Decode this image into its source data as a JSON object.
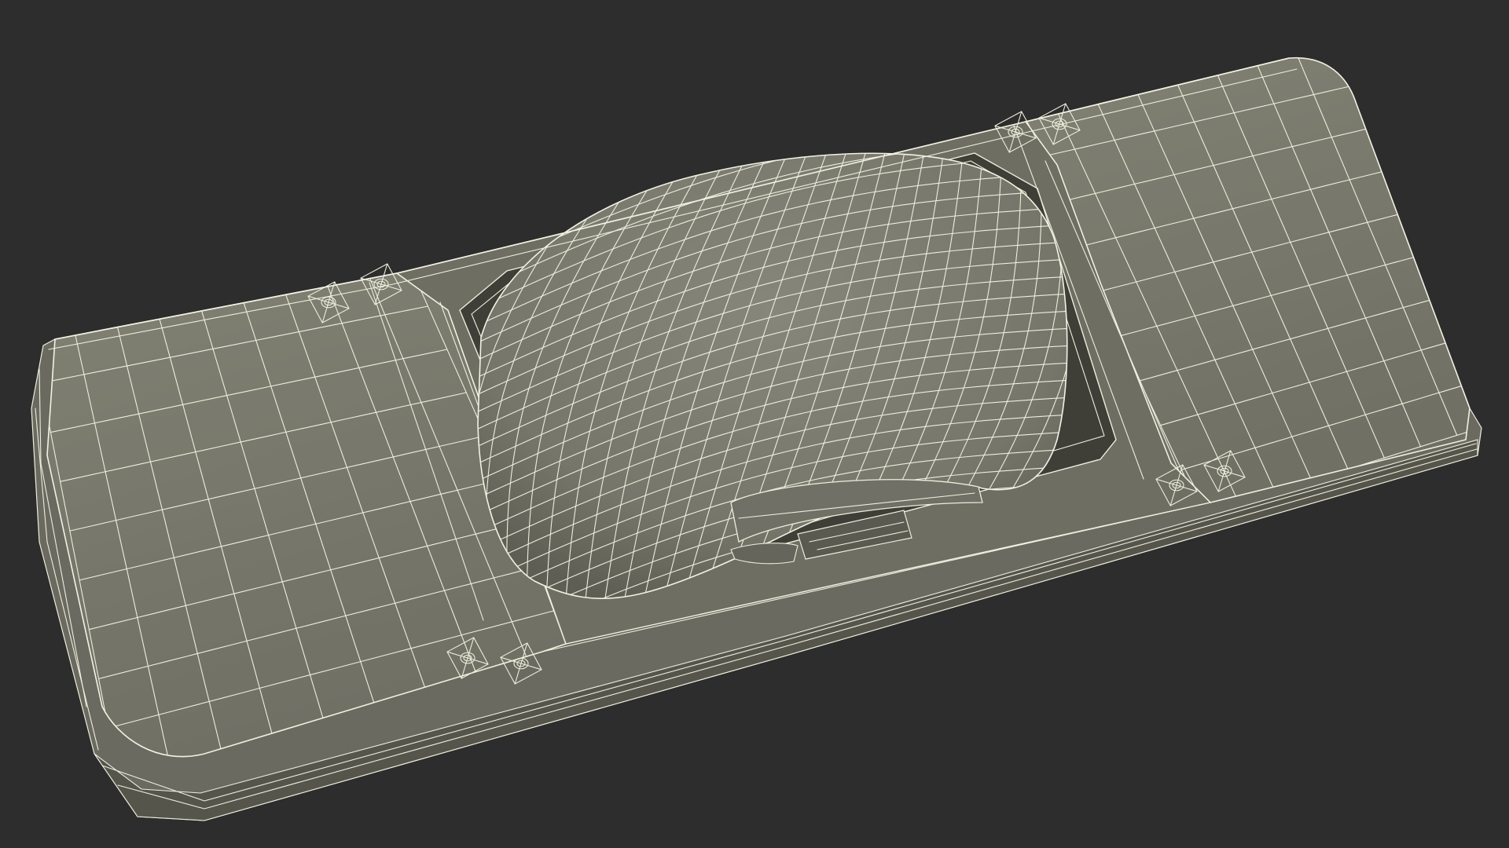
{
  "scene": {
    "subject": "onewheel-board-wireframe-render",
    "colors": {
      "background": "#2d2d2d",
      "surface": "#7b7b6e",
      "surface_dark": "#5f5f55",
      "surface_shadow": "#45453d",
      "wire": "#eeeedd"
    }
  }
}
